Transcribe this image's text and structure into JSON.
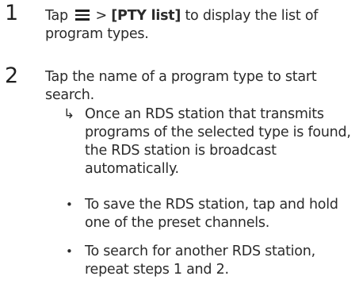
{
  "steps": [
    {
      "number": "1",
      "before_icon": "Tap",
      "icon": "menu-icon",
      "middle": ">",
      "bold_label": "[PTY list]",
      "after": "to display the list of program types."
    },
    {
      "number": "2",
      "text": "Tap the name of a program type to start search.",
      "result": "Once an RDS station that transmits programs of the selected type is found, the RDS station is broadcast automatically.",
      "result_marker": "↳",
      "bullets": [
        {
          "marker": "•",
          "text": "To save the RDS station, tap and hold one of the preset channels."
        },
        {
          "marker": "•",
          "text": "To search for another RDS station, repeat steps 1 and 2."
        }
      ]
    }
  ]
}
